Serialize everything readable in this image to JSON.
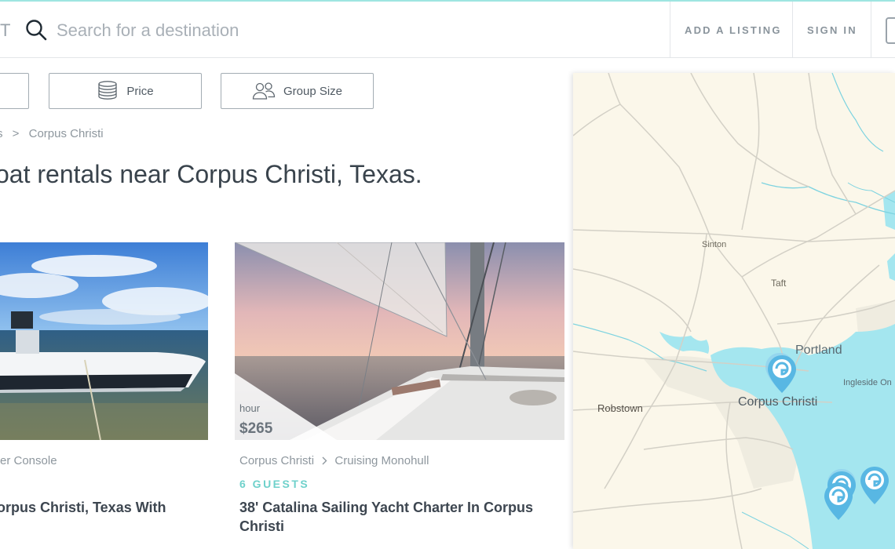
{
  "header": {
    "logo_fragment": "T",
    "search_placeholder": "Search for a destination",
    "add_listing": "ADD A LISTING",
    "sign_in": "SIGN IN"
  },
  "filters": {
    "price": "Price",
    "group_size": "Group Size"
  },
  "breadcrumb": {
    "separator": ">",
    "current": "Corpus Christi"
  },
  "page_title": "oat rentals near Corpus Christi, Texas.",
  "listings": [
    {
      "meta": "er Console",
      "title": "orpus Christi, Texas With"
    },
    {
      "price_unit": "hour",
      "price": "$265",
      "location": "Corpus Christi",
      "category": "Cruising Monohull",
      "guests": "6 GUESTS",
      "title_line1": "38' Catalina Sailing Yacht Charter In Corpus",
      "title_line2": "Christi"
    }
  ],
  "map": {
    "labels": {
      "sinton": "Sinton",
      "taft": "Taft",
      "portland": "Portland",
      "ingleside": "Ingleside On",
      "robstown": "Robstown",
      "corpus_christi": "Corpus Christi"
    },
    "colors": {
      "land": "#fbf7ea",
      "water": "#a4e6ef",
      "urban": "#efece0",
      "pin": "#58b7e3"
    }
  }
}
